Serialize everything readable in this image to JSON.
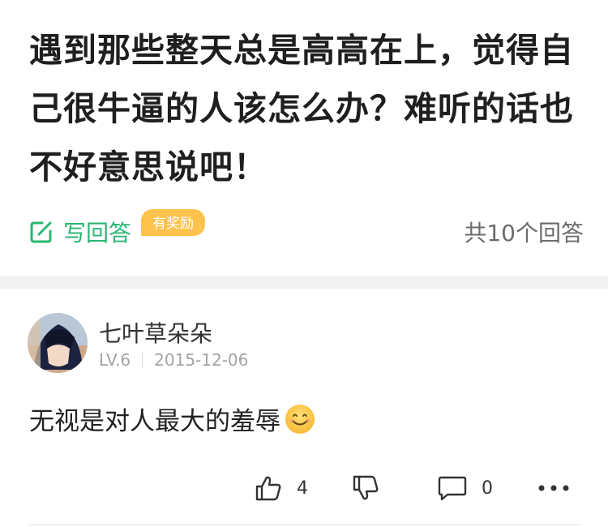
{
  "question": {
    "title": "遇到那些整天总是高高在上，觉得自己很牛逼的人该怎么办？难听的话也不好意思说吧！",
    "write_answer_label": "写回答",
    "reward_badge": "有奖励",
    "answer_count": "共10个回答"
  },
  "answer": {
    "author_name": "七叶草朵朵",
    "level": "LV.6",
    "date": "2015-12-06",
    "text": "无视是对人最大的羞辱",
    "likes": "4",
    "comments": "0"
  },
  "colors": {
    "accent_green": "#2bb673",
    "reward_yellow": "#ffc24c",
    "divider_gray": "#f2f2f2"
  },
  "icons": [
    "edit-icon",
    "smile-emoji-icon",
    "thumbs-up-icon",
    "thumbs-down-icon",
    "comment-icon",
    "more-icon"
  ]
}
